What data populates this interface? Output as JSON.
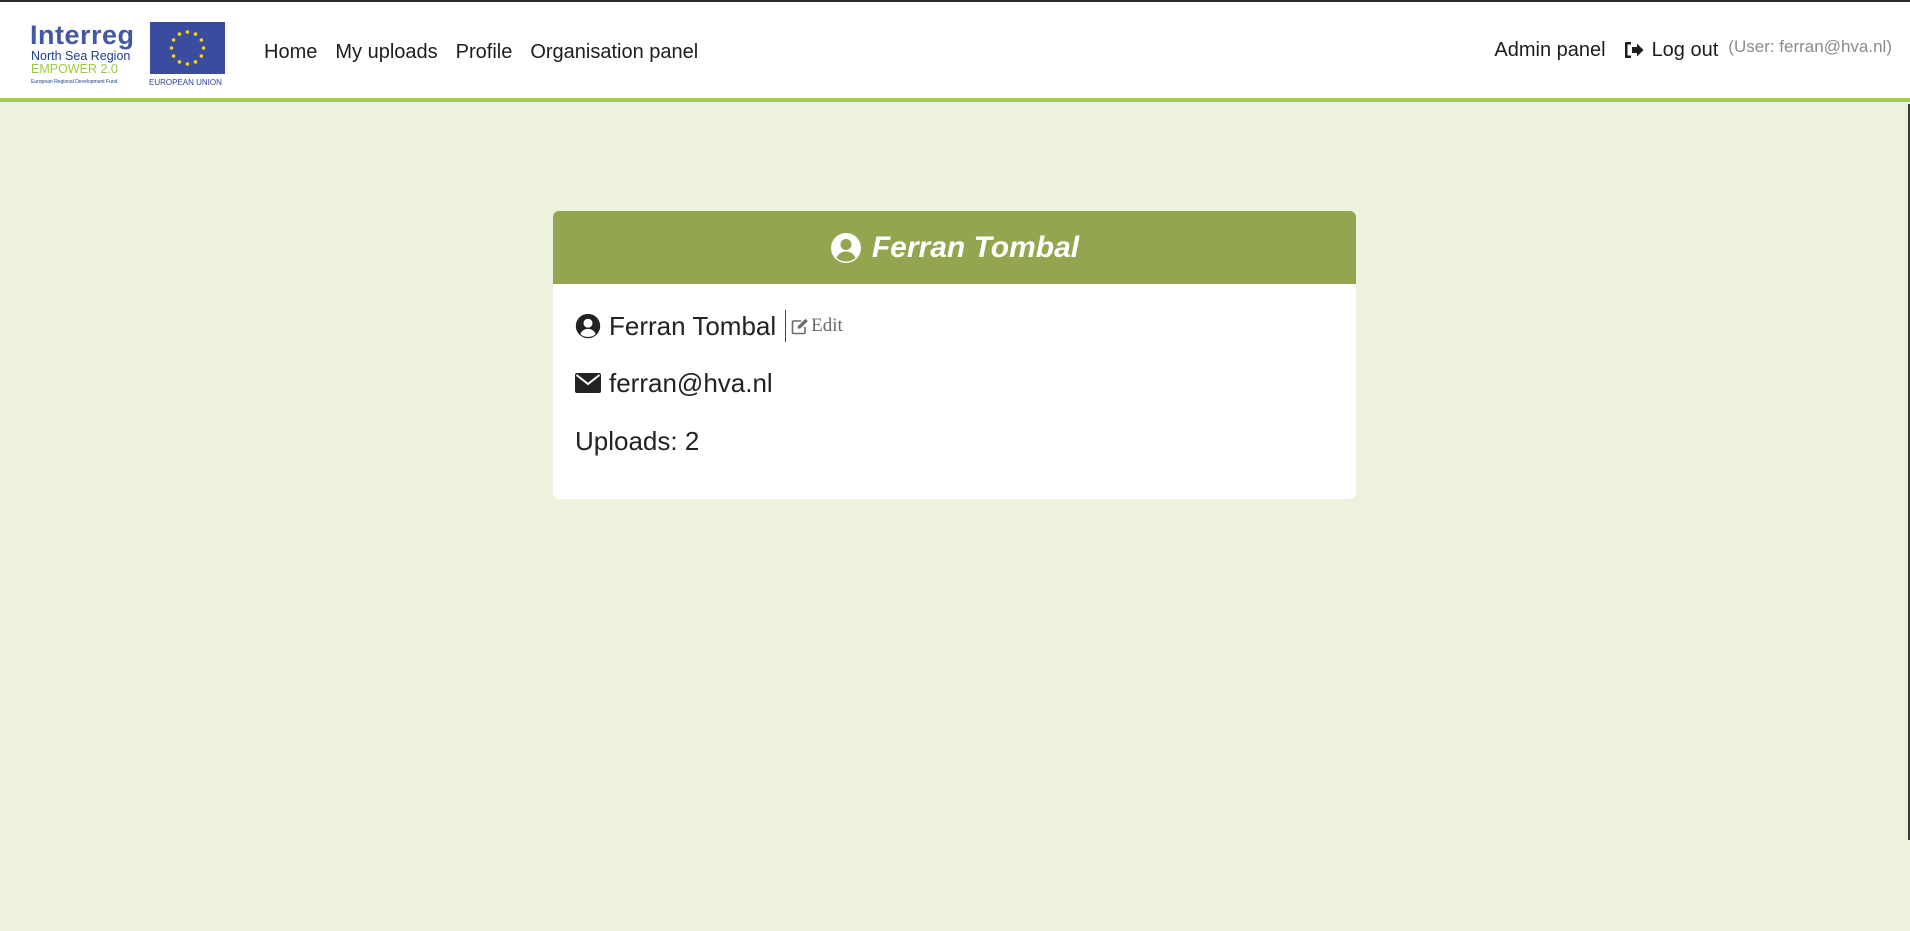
{
  "logo": {
    "title": "Interreg",
    "line1": "North Sea Region",
    "line2": "EMPOWER 2.0",
    "line3": "European Regional Development Fund",
    "eu_label": "EUROPEAN UNION"
  },
  "nav": {
    "left": [
      {
        "label": "Home"
      },
      {
        "label": "My uploads"
      },
      {
        "label": "Profile"
      },
      {
        "label": "Organisation panel"
      }
    ],
    "admin": "Admin panel",
    "logout": "Log out",
    "user_info": "(User: ferran@hva.nl)"
  },
  "profile": {
    "header_name": "Ferran Tombal",
    "name": "Ferran Tombal",
    "edit_label": "Edit",
    "email": "ferran@hva.nl",
    "uploads": "Uploads: 2"
  },
  "colors": {
    "page_bg": "#edf2df",
    "nav_border": "#a6c853",
    "card_header": "#93a64f"
  },
  "icons": {
    "header_user": "user-circle-icon",
    "name_user": "user-circle-icon",
    "edit": "edit-icon",
    "email": "envelope-icon",
    "logout": "sign-out-icon"
  }
}
